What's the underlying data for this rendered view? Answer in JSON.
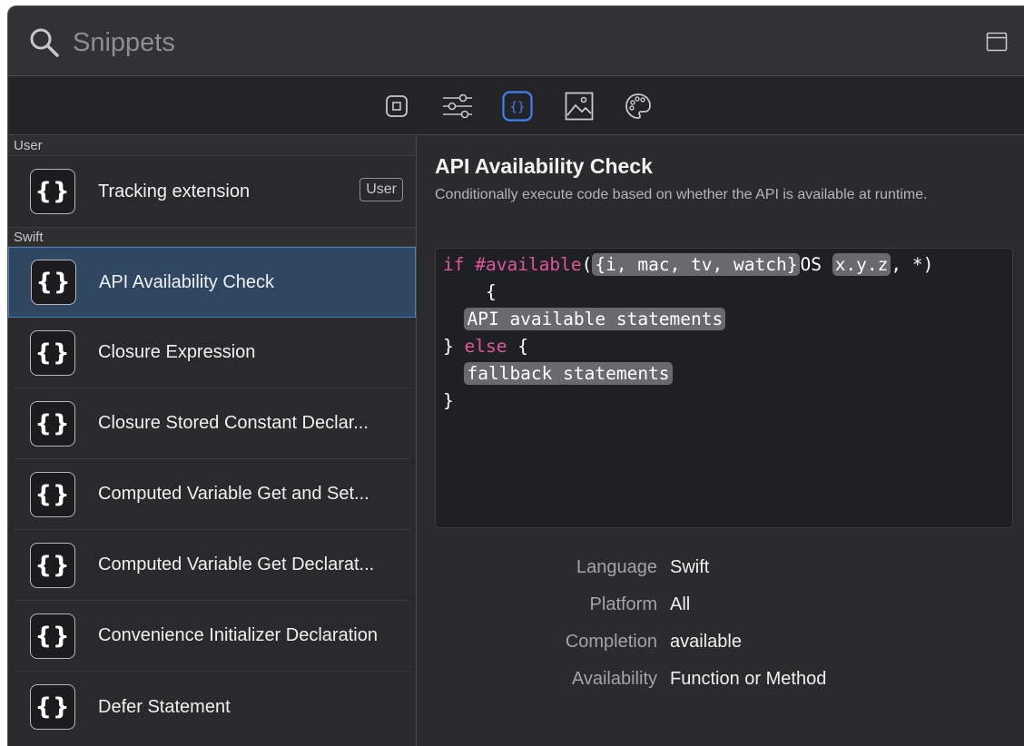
{
  "search": {
    "placeholder": "Snippets"
  },
  "toolbar": {
    "tabs": [
      {
        "icon": "square-icon",
        "selected": false
      },
      {
        "icon": "sliders-icon",
        "selected": false
      },
      {
        "icon": "braces-icon",
        "selected": true
      },
      {
        "icon": "image-icon",
        "selected": false
      },
      {
        "icon": "palette-icon",
        "selected": false
      }
    ],
    "accent": "#3b82f6"
  },
  "sidebar": {
    "sections": [
      {
        "title": "User",
        "items": [
          {
            "label": "Tracking extension",
            "badge": "User",
            "icon_glyph": "{}"
          }
        ]
      },
      {
        "title": "Swift",
        "items": [
          {
            "label": "API Availability Check",
            "selected": true,
            "icon_glyph": "{}"
          },
          {
            "label": "Closure Expression",
            "icon_glyph": "{}"
          },
          {
            "label": "Closure Stored Constant Declar...",
            "icon_glyph": "{}"
          },
          {
            "label": "Computed Variable Get and Set...",
            "icon_glyph": "{}"
          },
          {
            "label": "Computed Variable Get Declarat...",
            "icon_glyph": "{}"
          },
          {
            "label": "Convenience Initializer Declaration",
            "icon_glyph": "{}"
          },
          {
            "label": "Defer Statement",
            "icon_glyph": "{}"
          }
        ]
      }
    ]
  },
  "detail": {
    "title": "API Availability Check",
    "description": "Conditionally execute code based on whether the API is available at runtime.",
    "code": {
      "l1_kw_if": "if",
      "l1_kw_avail": "#available",
      "l1_paren": "(",
      "l1_ph1": "{i, mac, tv, watch}",
      "l1_os": "OS ",
      "l1_ph2": "x.y.z",
      "l1_end": ", *)",
      "l2": "    {",
      "l3_ph": "API available statements",
      "l4_brace": "} ",
      "l4_kw": "else",
      "l4_end": " {",
      "l5_ph": "fallback statements",
      "l6": "}"
    },
    "properties": [
      {
        "key": "Language",
        "value": "Swift"
      },
      {
        "key": "Platform",
        "value": "All"
      },
      {
        "key": "Completion",
        "value": "available"
      },
      {
        "key": "Availability",
        "value": "Function or Method"
      }
    ]
  },
  "colors": {
    "keyword": "#e0559c",
    "selection": "#2f4760",
    "selection_border": "#4a7fc0"
  }
}
